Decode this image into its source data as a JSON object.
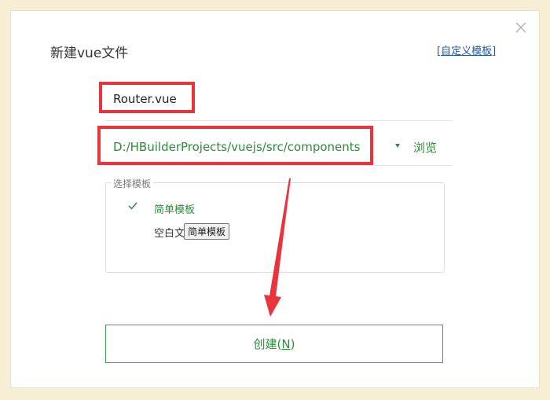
{
  "dialog": {
    "title": "新建vue文件",
    "custom_template_link": "[自定义模板]"
  },
  "form": {
    "filename_value": "Router.vue",
    "path_value": "D:/HBuilderProjects/vuejs/src/components",
    "browse_label": "浏览"
  },
  "template_group": {
    "legend": "选择模板",
    "items": [
      {
        "label": "简单模板",
        "selected": true
      },
      {
        "label": "空白文"
      }
    ],
    "tooltip": "简单模板"
  },
  "create_button": {
    "label_prefix": "创建(",
    "mnemonic": "N",
    "label_suffix": ")"
  },
  "colors": {
    "accent_green": "#2e8b3a",
    "annotation_red": "#e8343a",
    "page_background": "#f7efd4"
  },
  "icons": {
    "close": "close-icon",
    "check": "check-icon",
    "dropdown": "chevron-down-icon"
  }
}
